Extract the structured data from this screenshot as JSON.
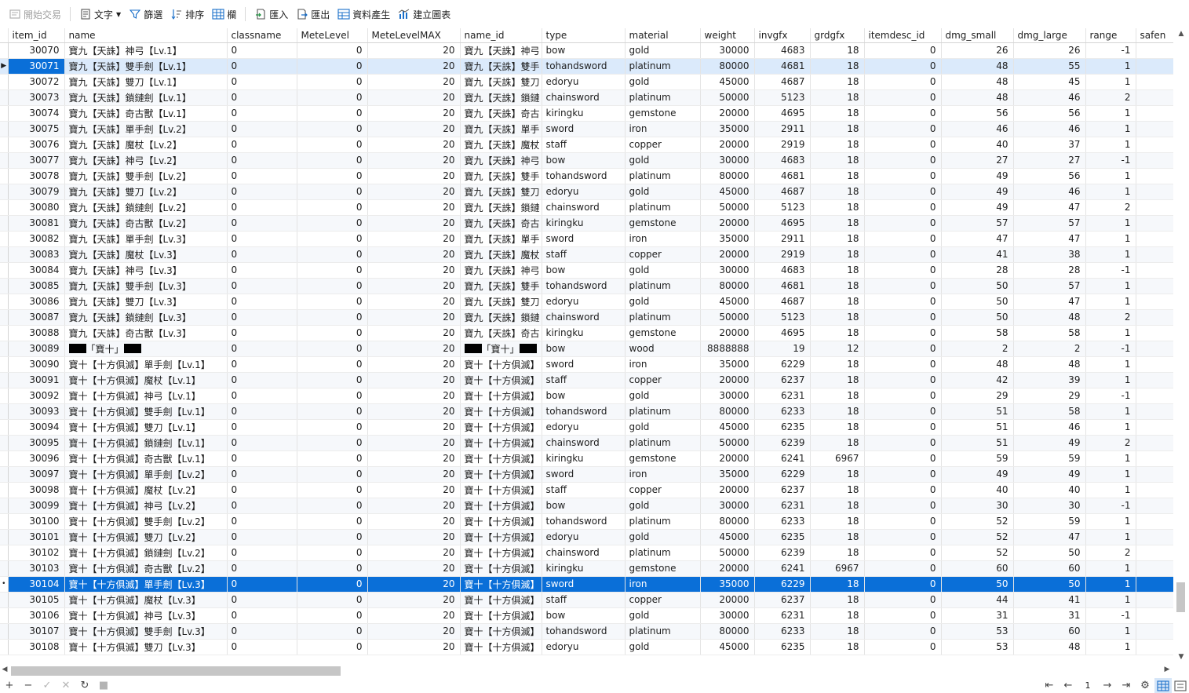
{
  "toolbar": {
    "begin_transaction": "開始交易",
    "text": "文字",
    "filter": "篩選",
    "sort": "排序",
    "columns": "欄",
    "import": "匯入",
    "export": "匯出",
    "data_generation": "資料產生",
    "create_chart": "建立圖表"
  },
  "columns": [
    "item_id",
    "name",
    "classname",
    "MeteLevel",
    "MeteLevelMAX",
    "name_id",
    "type",
    "material",
    "weight",
    "invgfx",
    "grdgfx",
    "itemdesc_id",
    "dmg_small",
    "dmg_large",
    "range",
    "safen"
  ],
  "rows": [
    [
      "30070",
      "寶九【天誅】神弓【Lv.1】",
      "0",
      "0",
      "20",
      "寶九【天誅】神弓",
      "bow",
      "gold",
      "30000",
      "4683",
      "18",
      "0",
      "26",
      "26",
      "-1",
      ""
    ],
    [
      "30071",
      "寶九【天誅】雙手劍【Lv.1】",
      "0",
      "0",
      "20",
      "寶九【天誅】雙手",
      "tohandsword",
      "platinum",
      "80000",
      "4681",
      "18",
      "0",
      "48",
      "55",
      "1",
      ""
    ],
    [
      "30072",
      "寶九【天誅】雙刀【Lv.1】",
      "0",
      "0",
      "20",
      "寶九【天誅】雙刀",
      "edoryu",
      "gold",
      "45000",
      "4687",
      "18",
      "0",
      "48",
      "45",
      "1",
      ""
    ],
    [
      "30073",
      "寶九【天誅】鎖鏈劍【Lv.1】",
      "0",
      "0",
      "20",
      "寶九【天誅】鎖鏈",
      "chainsword",
      "platinum",
      "50000",
      "5123",
      "18",
      "0",
      "48",
      "46",
      "2",
      ""
    ],
    [
      "30074",
      "寶九【天誅】奇古獸【Lv.1】",
      "0",
      "0",
      "20",
      "寶九【天誅】奇古",
      "kiringku",
      "gemstone",
      "20000",
      "4695",
      "18",
      "0",
      "56",
      "56",
      "1",
      ""
    ],
    [
      "30075",
      "寶九【天誅】單手劍【Lv.2】",
      "0",
      "0",
      "20",
      "寶九【天誅】單手",
      "sword",
      "iron",
      "35000",
      "2911",
      "18",
      "0",
      "46",
      "46",
      "1",
      ""
    ],
    [
      "30076",
      "寶九【天誅】魔杖【Lv.2】",
      "0",
      "0",
      "20",
      "寶九【天誅】魔杖",
      "staff",
      "copper",
      "20000",
      "2919",
      "18",
      "0",
      "40",
      "37",
      "1",
      ""
    ],
    [
      "30077",
      "寶九【天誅】神弓【Lv.2】",
      "0",
      "0",
      "20",
      "寶九【天誅】神弓",
      "bow",
      "gold",
      "30000",
      "4683",
      "18",
      "0",
      "27",
      "27",
      "-1",
      ""
    ],
    [
      "30078",
      "寶九【天誅】雙手劍【Lv.2】",
      "0",
      "0",
      "20",
      "寶九【天誅】雙手",
      "tohandsword",
      "platinum",
      "80000",
      "4681",
      "18",
      "0",
      "49",
      "56",
      "1",
      ""
    ],
    [
      "30079",
      "寶九【天誅】雙刀【Lv.2】",
      "0",
      "0",
      "20",
      "寶九【天誅】雙刀",
      "edoryu",
      "gold",
      "45000",
      "4687",
      "18",
      "0",
      "49",
      "46",
      "1",
      ""
    ],
    [
      "30080",
      "寶九【天誅】鎖鏈劍【Lv.2】",
      "0",
      "0",
      "20",
      "寶九【天誅】鎖鏈",
      "chainsword",
      "platinum",
      "50000",
      "5123",
      "18",
      "0",
      "49",
      "47",
      "2",
      ""
    ],
    [
      "30081",
      "寶九【天誅】奇古獸【Lv.2】",
      "0",
      "0",
      "20",
      "寶九【天誅】奇古",
      "kiringku",
      "gemstone",
      "20000",
      "4695",
      "18",
      "0",
      "57",
      "57",
      "1",
      ""
    ],
    [
      "30082",
      "寶九【天誅】單手劍【Lv.3】",
      "0",
      "0",
      "20",
      "寶九【天誅】單手",
      "sword",
      "iron",
      "35000",
      "2911",
      "18",
      "0",
      "47",
      "47",
      "1",
      ""
    ],
    [
      "30083",
      "寶九【天誅】魔杖【Lv.3】",
      "0",
      "0",
      "20",
      "寶九【天誅】魔杖",
      "staff",
      "copper",
      "20000",
      "2919",
      "18",
      "0",
      "41",
      "38",
      "1",
      ""
    ],
    [
      "30084",
      "寶九【天誅】神弓【Lv.3】",
      "0",
      "0",
      "20",
      "寶九【天誅】神弓",
      "bow",
      "gold",
      "30000",
      "4683",
      "18",
      "0",
      "28",
      "28",
      "-1",
      ""
    ],
    [
      "30085",
      "寶九【天誅】雙手劍【Lv.3】",
      "0",
      "0",
      "20",
      "寶九【天誅】雙手",
      "tohandsword",
      "platinum",
      "80000",
      "4681",
      "18",
      "0",
      "50",
      "57",
      "1",
      ""
    ],
    [
      "30086",
      "寶九【天誅】雙刀【Lv.3】",
      "0",
      "0",
      "20",
      "寶九【天誅】雙刀",
      "edoryu",
      "gold",
      "45000",
      "4687",
      "18",
      "0",
      "50",
      "47",
      "1",
      ""
    ],
    [
      "30087",
      "寶九【天誅】鎖鏈劍【Lv.3】",
      "0",
      "0",
      "20",
      "寶九【天誅】鎖鏈",
      "chainsword",
      "platinum",
      "50000",
      "5123",
      "18",
      "0",
      "50",
      "48",
      "2",
      ""
    ],
    [
      "30088",
      "寶九【天誅】奇古獸【Lv.3】",
      "0",
      "0",
      "20",
      "寶九【天誅】奇古",
      "kiringku",
      "gemstone",
      "20000",
      "4695",
      "18",
      "0",
      "58",
      "58",
      "1",
      ""
    ],
    [
      "30089",
      "「寶十」",
      "0",
      "0",
      "20",
      "「寶十」",
      "bow",
      "wood",
      "8888888",
      "19",
      "12",
      "0",
      "2",
      "2",
      "-1",
      ""
    ],
    [
      "30090",
      "寶十【十方俱滅】單手劍【Lv.1】",
      "0",
      "0",
      "20",
      "寶十【十方俱滅】",
      "sword",
      "iron",
      "35000",
      "6229",
      "18",
      "0",
      "48",
      "48",
      "1",
      ""
    ],
    [
      "30091",
      "寶十【十方俱滅】魔杖【Lv.1】",
      "0",
      "0",
      "20",
      "寶十【十方俱滅】",
      "staff",
      "copper",
      "20000",
      "6237",
      "18",
      "0",
      "42",
      "39",
      "1",
      ""
    ],
    [
      "30092",
      "寶十【十方俱滅】神弓【Lv.1】",
      "0",
      "0",
      "20",
      "寶十【十方俱滅】",
      "bow",
      "gold",
      "30000",
      "6231",
      "18",
      "0",
      "29",
      "29",
      "-1",
      ""
    ],
    [
      "30093",
      "寶十【十方俱滅】雙手劍【Lv.1】",
      "0",
      "0",
      "20",
      "寶十【十方俱滅】",
      "tohandsword",
      "platinum",
      "80000",
      "6233",
      "18",
      "0",
      "51",
      "58",
      "1",
      ""
    ],
    [
      "30094",
      "寶十【十方俱滅】雙刀【Lv.1】",
      "0",
      "0",
      "20",
      "寶十【十方俱滅】",
      "edoryu",
      "gold",
      "45000",
      "6235",
      "18",
      "0",
      "51",
      "46",
      "1",
      ""
    ],
    [
      "30095",
      "寶十【十方俱滅】鎖鏈劍【Lv.1】",
      "0",
      "0",
      "20",
      "寶十【十方俱滅】",
      "chainsword",
      "platinum",
      "50000",
      "6239",
      "18",
      "0",
      "51",
      "49",
      "2",
      ""
    ],
    [
      "30096",
      "寶十【十方俱滅】奇古獸【Lv.1】",
      "0",
      "0",
      "20",
      "寶十【十方俱滅】",
      "kiringku",
      "gemstone",
      "20000",
      "6241",
      "6967",
      "0",
      "59",
      "59",
      "1",
      ""
    ],
    [
      "30097",
      "寶十【十方俱滅】單手劍【Lv.2】",
      "0",
      "0",
      "20",
      "寶十【十方俱滅】",
      "sword",
      "iron",
      "35000",
      "6229",
      "18",
      "0",
      "49",
      "49",
      "1",
      ""
    ],
    [
      "30098",
      "寶十【十方俱滅】魔杖【Lv.2】",
      "0",
      "0",
      "20",
      "寶十【十方俱滅】",
      "staff",
      "copper",
      "20000",
      "6237",
      "18",
      "0",
      "40",
      "40",
      "1",
      ""
    ],
    [
      "30099",
      "寶十【十方俱滅】神弓【Lv.2】",
      "0",
      "0",
      "20",
      "寶十【十方俱滅】",
      "bow",
      "gold",
      "30000",
      "6231",
      "18",
      "0",
      "30",
      "30",
      "-1",
      ""
    ],
    [
      "30100",
      "寶十【十方俱滅】雙手劍【Lv.2】",
      "0",
      "0",
      "20",
      "寶十【十方俱滅】",
      "tohandsword",
      "platinum",
      "80000",
      "6233",
      "18",
      "0",
      "52",
      "59",
      "1",
      ""
    ],
    [
      "30101",
      "寶十【十方俱滅】雙刀【Lv.2】",
      "0",
      "0",
      "20",
      "寶十【十方俱滅】",
      "edoryu",
      "gold",
      "45000",
      "6235",
      "18",
      "0",
      "52",
      "47",
      "1",
      ""
    ],
    [
      "30102",
      "寶十【十方俱滅】鎖鏈劍【Lv.2】",
      "0",
      "0",
      "20",
      "寶十【十方俱滅】",
      "chainsword",
      "platinum",
      "50000",
      "6239",
      "18",
      "0",
      "52",
      "50",
      "2",
      ""
    ],
    [
      "30103",
      "寶十【十方俱滅】奇古獸【Lv.2】",
      "0",
      "0",
      "20",
      "寶十【十方俱滅】",
      "kiringku",
      "gemstone",
      "20000",
      "6241",
      "6967",
      "0",
      "60",
      "60",
      "1",
      ""
    ],
    [
      "30104",
      "寶十【十方俱滅】單手劍【Lv.3】",
      "0",
      "0",
      "20",
      "寶十【十方俱滅】",
      "sword",
      "iron",
      "35000",
      "6229",
      "18",
      "0",
      "50",
      "50",
      "1",
      ""
    ],
    [
      "30105",
      "寶十【十方俱滅】魔杖【Lv.3】",
      "0",
      "0",
      "20",
      "寶十【十方俱滅】",
      "staff",
      "copper",
      "20000",
      "6237",
      "18",
      "0",
      "44",
      "41",
      "1",
      ""
    ],
    [
      "30106",
      "寶十【十方俱滅】神弓【Lv.3】",
      "0",
      "0",
      "20",
      "寶十【十方俱滅】",
      "bow",
      "gold",
      "30000",
      "6231",
      "18",
      "0",
      "31",
      "31",
      "-1",
      ""
    ],
    [
      "30107",
      "寶十【十方俱滅】雙手劍【Lv.3】",
      "0",
      "0",
      "20",
      "寶十【十方俱滅】",
      "tohandsword",
      "platinum",
      "80000",
      "6233",
      "18",
      "0",
      "53",
      "60",
      "1",
      ""
    ],
    [
      "30108",
      "寶十【十方俱滅】雙刀【Lv.3】",
      "0",
      "0",
      "20",
      "寶十【十方俱滅】",
      "edoryu",
      "gold",
      "45000",
      "6235",
      "18",
      "0",
      "53",
      "48",
      "1",
      ""
    ]
  ],
  "selected_soft_row": 1,
  "selected_soft_row_indicator": "▶",
  "selected_row": 34,
  "selected_row_indicator": "•",
  "redacted_row": 19,
  "pagination": {
    "page": "1"
  },
  "colors": {
    "selection": "#0a6fd8",
    "selection_soft": "#dbeafb",
    "accent": "#1a6fc9"
  },
  "icons": {
    "begin_transaction": "transaction-icon",
    "text": "text-icon",
    "filter": "filter-icon",
    "sort": "sort-icon",
    "columns": "columns-icon",
    "import": "import-icon",
    "export": "export-icon",
    "data_generation": "data-generation-icon",
    "create_chart": "chart-icon"
  }
}
